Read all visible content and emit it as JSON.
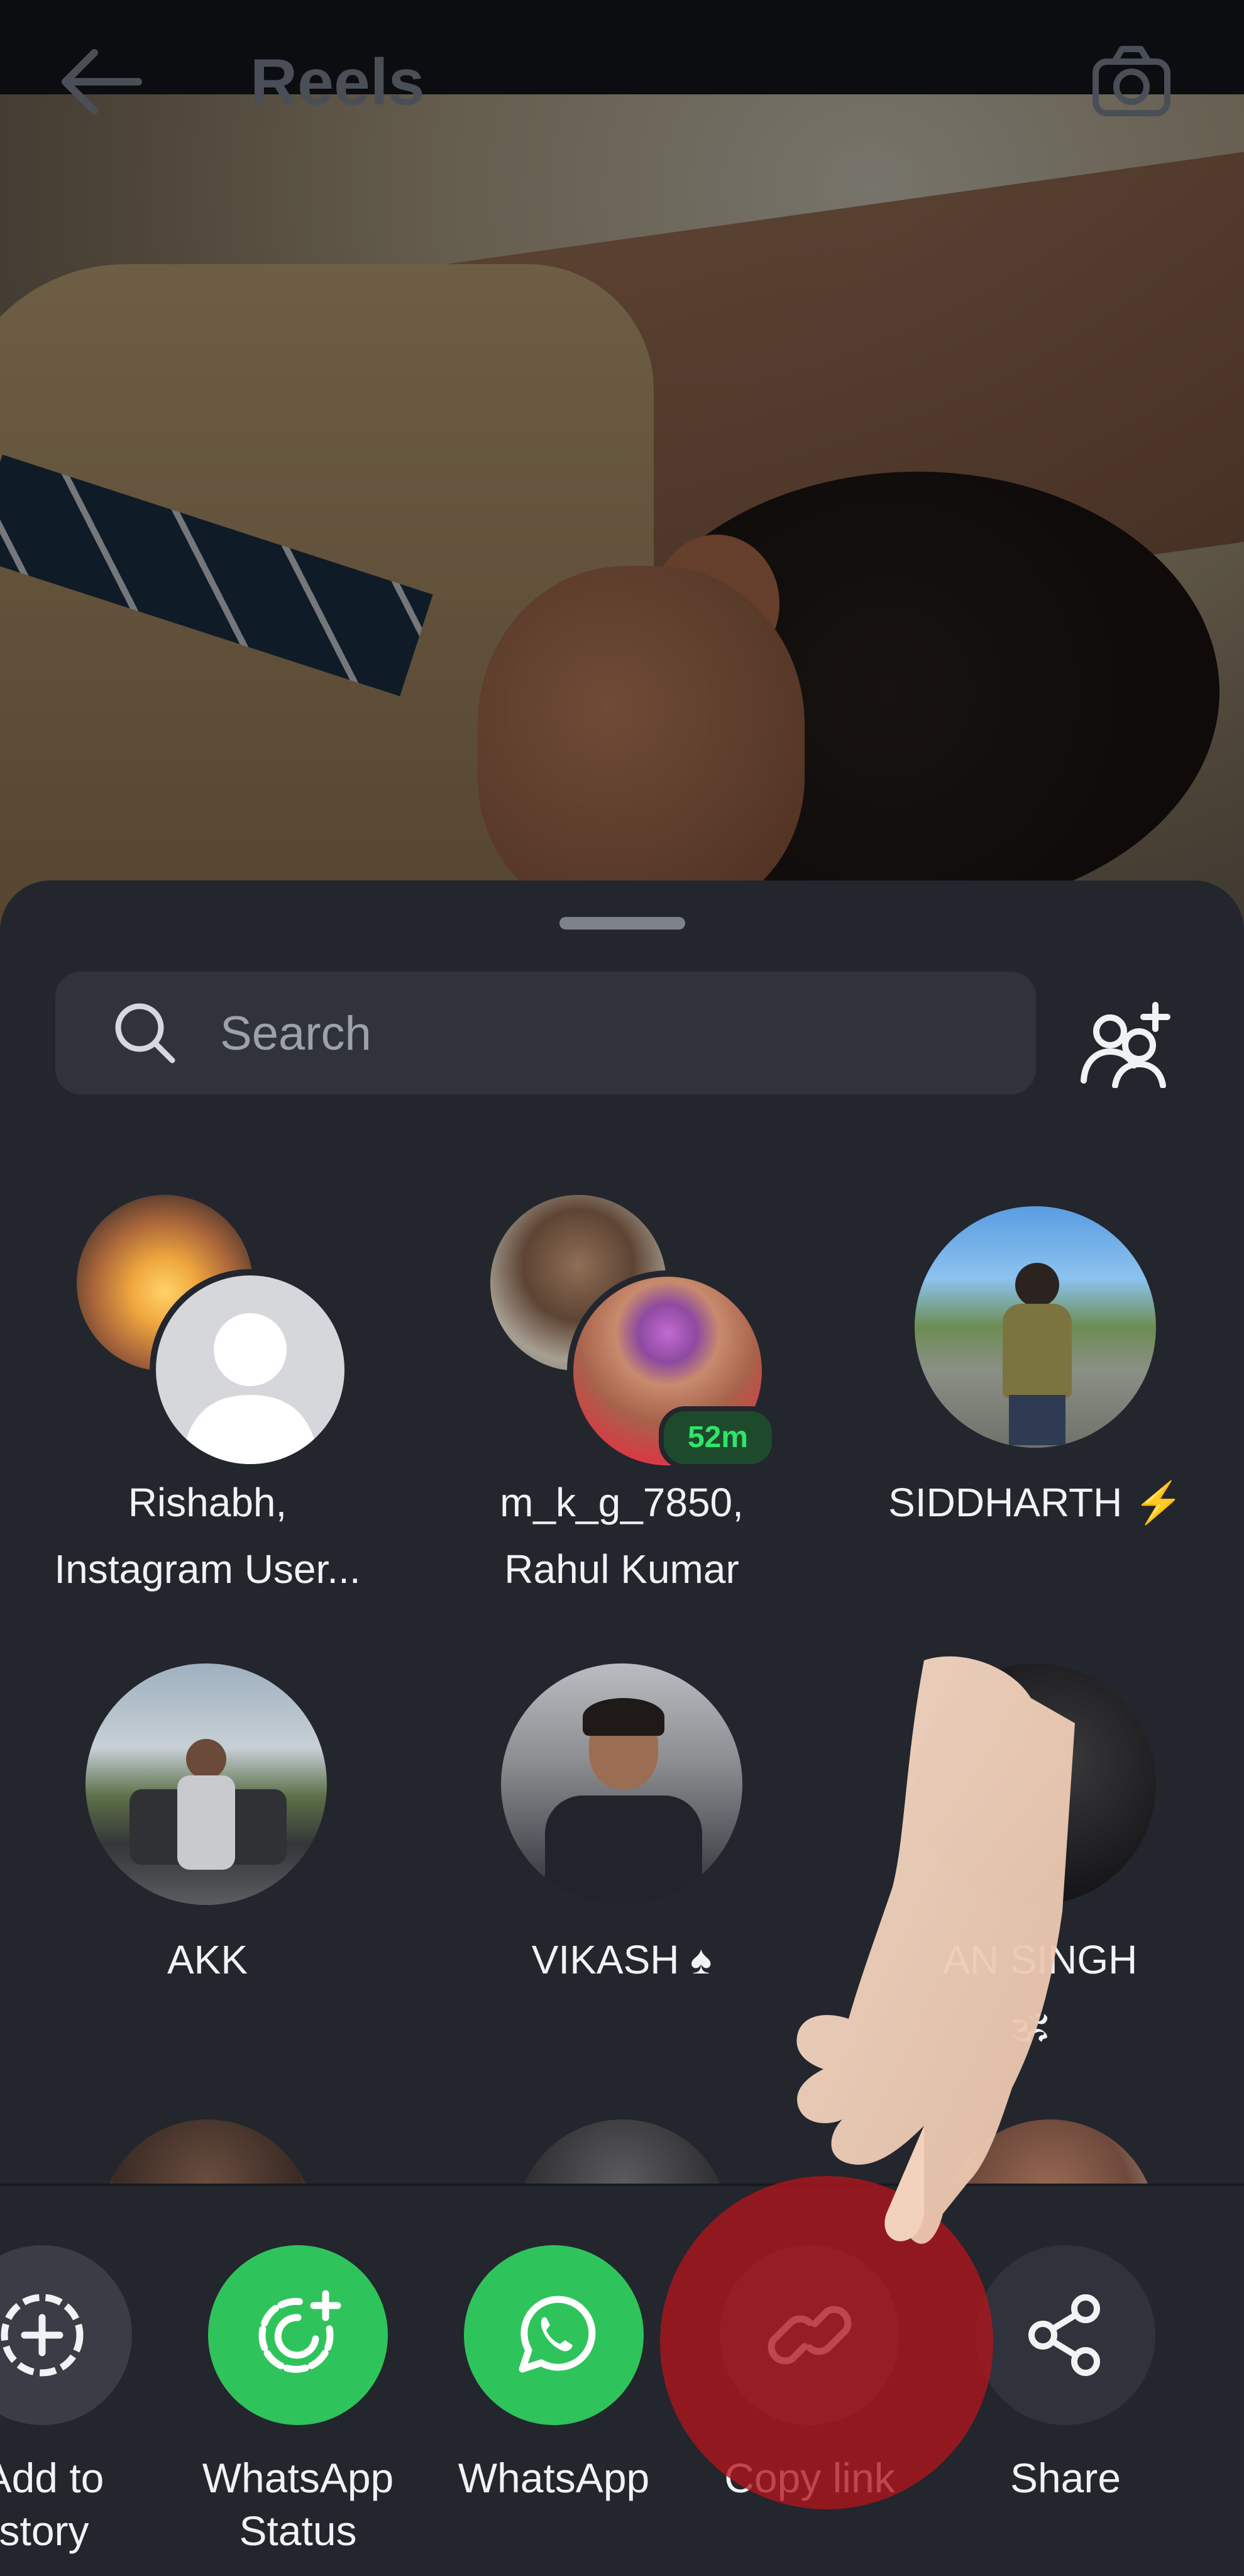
{
  "topbar": {
    "title": "Reels",
    "back_icon": "arrow-left-icon",
    "camera_icon": "camera-icon"
  },
  "search": {
    "placeholder": "Search",
    "value": ""
  },
  "contacts": [
    {
      "name_line1": "Rishabh,",
      "name_line2": "Instagram User..."
    },
    {
      "name_line1": "m_k_g_7850,",
      "name_line2": "Rahul Kumar",
      "badge": "52m"
    },
    {
      "name_line1": "SIDDHARTH ⚡",
      "name_line2": ""
    },
    {
      "name_line1": "AKK",
      "name_line2": ""
    },
    {
      "name_line1": "VIKASH ♠",
      "name_line2": ""
    },
    {
      "name_line1": "AN SINGH",
      "name_line2": "🕉"
    }
  ],
  "share_actions": [
    {
      "label_line1": "Add to",
      "label_line2": "story",
      "icon": "add-circle-icon"
    },
    {
      "label_line1": "WhatsApp",
      "label_line2": "Status",
      "icon": "whatsapp-status-icon"
    },
    {
      "label_line1": "WhatsApp",
      "label_line2": "",
      "icon": "whatsapp-icon"
    },
    {
      "label_line1": "Copy link",
      "label_line2": "",
      "icon": "link-icon"
    },
    {
      "label_line1": "Share",
      "label_line2": "",
      "icon": "share-icon"
    }
  ],
  "colors": {
    "whatsapp_green": "#2fc45b",
    "sheet_bg": "#23262d",
    "search_bg": "#30333b",
    "tap_red": "#b2141c",
    "badge_green": "#2ee56a"
  }
}
